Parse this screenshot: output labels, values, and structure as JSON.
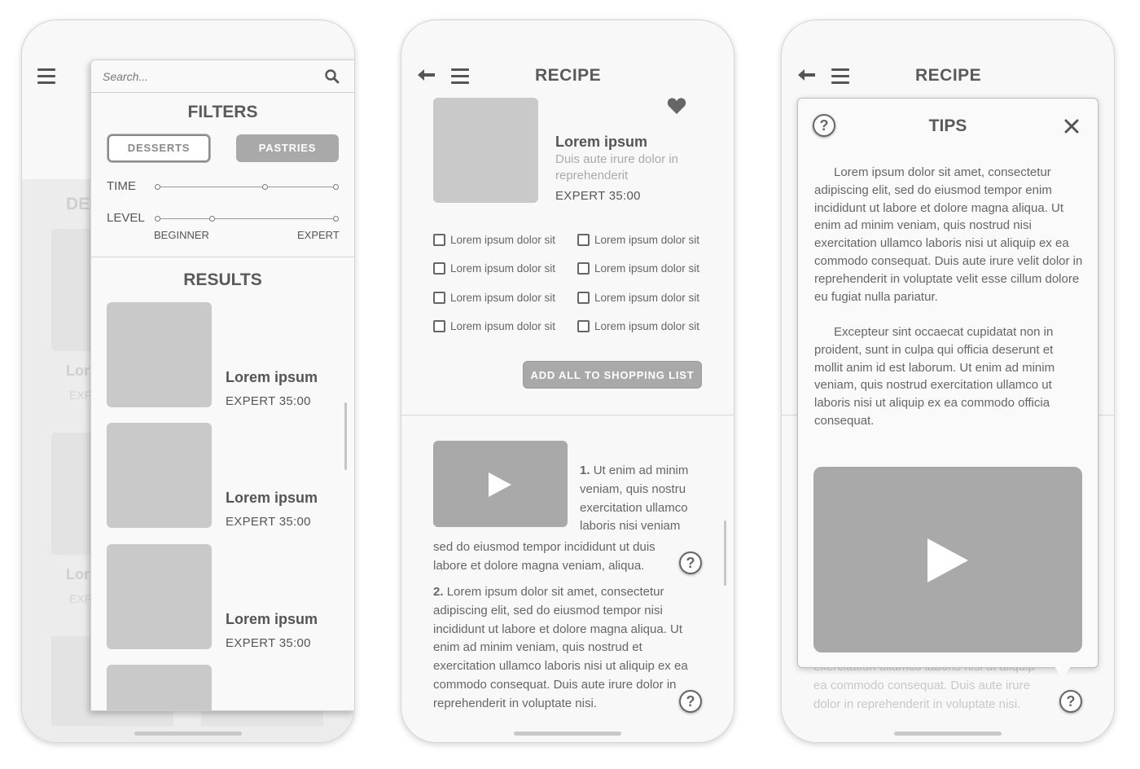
{
  "colors": {
    "placeholder_gray": "#c9c9c9",
    "video_gray": "#a9a9a9",
    "text_gray": "#555555",
    "accent_pill": "#a9a9a9"
  },
  "screen1": {
    "background": {
      "section_fragment": "DE",
      "card_titles": [
        "Lor",
        "Lor"
      ],
      "card_metas": [
        "EXF",
        "EXF"
      ]
    },
    "search": {
      "placeholder": "Search..."
    },
    "filters": {
      "title": "FILTERS",
      "chips": [
        {
          "label": "DESSERTS",
          "state": "outline"
        },
        {
          "label": "PASTRIES",
          "state": "selected"
        }
      ],
      "time_label": "TIME",
      "level_label": "LEVEL",
      "level_min_label": "BEGINNER",
      "level_max_label": "EXPERT",
      "time_range": [
        0,
        0.6
      ],
      "level_range": [
        0,
        0.3
      ]
    },
    "results": {
      "title": "RESULTS",
      "items": [
        {
          "title": "Lorem ipsum",
          "meta": "EXPERT 35:00"
        },
        {
          "title": "Lorem ipsum",
          "meta": "EXPERT 35:00"
        },
        {
          "title": "Lorem ipsum",
          "meta": "EXPERT 35:00"
        }
      ]
    }
  },
  "screen2": {
    "title": "RECIPE",
    "recipe": {
      "name": "Lorem ipsum",
      "subtitle": "Duis aute irure dolor in reprehenderit",
      "meta": "EXPERT 35:00"
    },
    "ingredients": [
      "Lorem ipsum dolor sit",
      "Lorem ipsum dolor sit",
      "Lorem ipsum dolor sit",
      "Lorem ipsum dolor sit",
      "Lorem ipsum dolor sit",
      "Lorem ipsum dolor sit",
      "Lorem ipsum dolor sit",
      "Lorem ipsum dolor sit"
    ],
    "add_button_label": "ADD ALL TO SHOPPING LIST",
    "steps": [
      {
        "number": "1.",
        "text_side": "Ut enim ad minim veniam, quis nostru exercitation ullamco laboris nisi veniam",
        "text_below": "sed do eiusmod tempor incididunt ut duis labore et dolore magna veniam, aliqua."
      },
      {
        "number": "2.",
        "text": "Lorem ipsum dolor sit amet, consectetur adipiscing elit, sed do eiusmod tempor nisi incididunt ut labore et dolore magna aliqua. Ut enim ad minim veniam, quis nostrud et exercitation ullamco laboris nisi ut aliquip ex ea commodo consequat. Duis aute irure dolor in reprehenderit in voluptate nisi."
      }
    ],
    "help_glyph": "?"
  },
  "screen3": {
    "title": "RECIPE",
    "tips": {
      "title": "TIPS",
      "paragraphs": [
        "Lorem ipsum dolor sit amet, consectetur adipiscing elit, sed do eiusmod tempor enim incididunt ut labore et dolore magna aliqua. Ut enim ad minim veniam, quis nostrud nisi exercitation ullamco laboris nisi ut aliquip ex ea commodo consequat. Duis aute irure velit dolor in reprehenderit in voluptate velit esse cillum dolore eu fugiat nulla pariatur.",
        "Excepteur sint occaecat cupidatat non in proident, sunt in culpa qui officia deserunt et mollit anim id est laborum. Ut enim ad minim veniam, quis nostrud exercitation ullamco ut laboris nisi ut aliquip ex ea commodo officia consequat."
      ]
    },
    "background_text": {
      "line1": "exercitation ullamco laboris nisi ut aliquip",
      "line2": "ea commodo consequat. Duis aute irure",
      "line3": "dolor in reprehenderit in voluptate nisi."
    },
    "help_glyph": "?"
  }
}
